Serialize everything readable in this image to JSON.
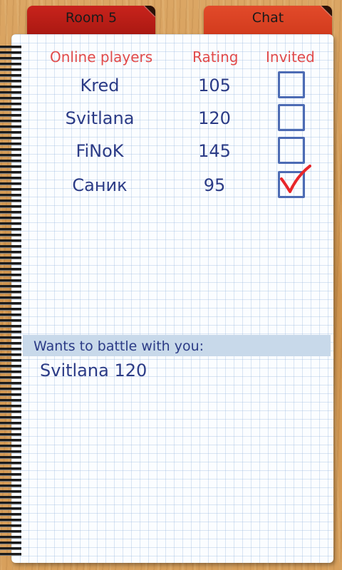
{
  "tabs": {
    "room": "Room 5",
    "chat": "Chat"
  },
  "table": {
    "headers": {
      "players": "Online players",
      "rating": "Rating",
      "invited": "Invited"
    },
    "rows": [
      {
        "name": "Kred",
        "rating": "105",
        "invited": false
      },
      {
        "name": "Svitlana",
        "rating": "120",
        "invited": false
      },
      {
        "name": "FiNoK",
        "rating": "145",
        "invited": false
      },
      {
        "name": "Саник",
        "rating": "95",
        "invited": true
      }
    ]
  },
  "battle": {
    "label": "Wants to battle with you:",
    "entry": "Svitlana 120"
  },
  "colors": {
    "header_red": "#e14a4a",
    "ink_blue": "#2b3b86",
    "checkbox_blue": "#4c6bb4",
    "check_red": "#e8262a",
    "tab_room": "#b81d16",
    "tab_chat": "#dd4424"
  }
}
